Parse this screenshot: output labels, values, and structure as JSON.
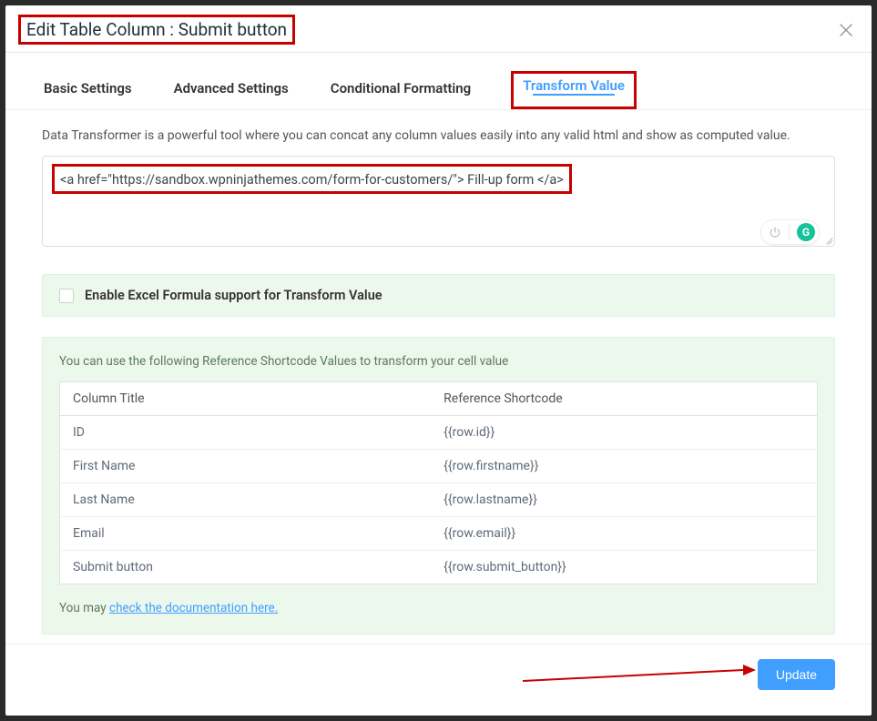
{
  "header": {
    "title": "Edit Table Column : Submit button"
  },
  "tabs": [
    {
      "label": "Basic Settings",
      "active": false
    },
    {
      "label": "Advanced Settings",
      "active": false
    },
    {
      "label": "Conditional Formatting",
      "active": false
    },
    {
      "label": "Transform Value",
      "active": true
    }
  ],
  "transform": {
    "description": "Data Transformer is a powerful tool where you can concat any column values easily into any valid html and show as computed value.",
    "textarea_value": "<a href=\"https://sandbox.wpninjathemes.com/form-for-customers/\"> Fill-up form </a>"
  },
  "excel_option": {
    "label": "Enable Excel Formula support for Transform Value",
    "checked": false
  },
  "reference": {
    "intro": "You can use the following Reference Shortcode Values to transform your cell value",
    "columns": [
      "Column Title",
      "Reference Shortcode"
    ],
    "rows": [
      {
        "title": "ID",
        "shortcode": "{{row.id}}"
      },
      {
        "title": "First Name",
        "shortcode": "{{row.firstname}}"
      },
      {
        "title": "Last Name",
        "shortcode": "{{row.lastname}}"
      },
      {
        "title": "Email",
        "shortcode": "{{row.email}}"
      },
      {
        "title": "Submit button",
        "shortcode": "{{row.submit_button}}"
      }
    ],
    "doc_prefix": "You may ",
    "doc_link": "check the documentation here."
  },
  "footer": {
    "update_label": "Update"
  },
  "icons": {
    "grammar_badge": "G"
  }
}
